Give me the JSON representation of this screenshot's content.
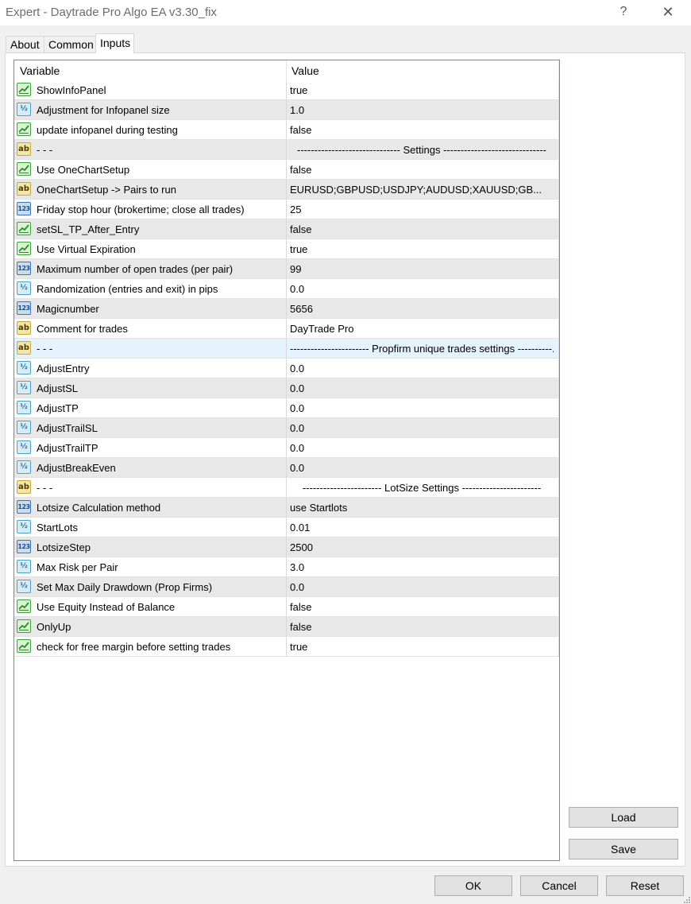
{
  "window": {
    "title": "Expert - Daytrade Pro Algo EA v3.30_fix",
    "help_label": "?",
    "close_label": "✕"
  },
  "tabs": [
    {
      "label": "About",
      "active": false
    },
    {
      "label": "Common",
      "active": false
    },
    {
      "label": "Inputs",
      "active": true
    }
  ],
  "grid": {
    "headers": {
      "variable": "Variable",
      "value": "Value"
    },
    "rows": [
      {
        "type": "bool",
        "icon": "bool-icon",
        "variable": "ShowInfoPanel",
        "value": "true"
      },
      {
        "type": "double",
        "icon": "double-icon",
        "variable": "Adjustment for Infopanel size",
        "value": "1.0"
      },
      {
        "type": "bool",
        "icon": "bool-icon",
        "variable": "update infopanel during testing",
        "value": "false"
      },
      {
        "type": "string",
        "icon": "string-icon",
        "variable": "- - -",
        "value": "------------------------------ Settings ------------------------------"
      },
      {
        "type": "bool",
        "icon": "bool-icon",
        "variable": "Use OneChartSetup",
        "value": "false"
      },
      {
        "type": "string",
        "icon": "string-icon",
        "variable": "OneChartSetup -> Pairs to run",
        "value": "EURUSD;GBPUSD;USDJPY;AUDUSD;XAUUSD;GB..."
      },
      {
        "type": "int",
        "icon": "int-icon",
        "variable": "Friday stop hour (brokertime; close all trades)",
        "value": "25"
      },
      {
        "type": "bool",
        "icon": "bool-icon",
        "variable": "setSL_TP_After_Entry",
        "value": "false"
      },
      {
        "type": "bool",
        "icon": "bool-icon",
        "variable": "Use Virtual Expiration",
        "value": "true"
      },
      {
        "type": "int",
        "icon": "int-icon",
        "variable": "Maximum number of open trades (per pair)",
        "value": "99"
      },
      {
        "type": "double",
        "icon": "double-icon",
        "variable": "Randomization (entries and exit) in pips",
        "value": "0.0"
      },
      {
        "type": "int",
        "icon": "int-icon",
        "variable": "Magicnumber",
        "value": "5656"
      },
      {
        "type": "string",
        "icon": "string-icon",
        "variable": "Comment for trades",
        "value": "DayTrade Pro"
      },
      {
        "type": "string",
        "icon": "string-icon",
        "variable": "- - -",
        "value": "----------------------- Propfirm unique trades settings ----------...",
        "selected": true
      },
      {
        "type": "double",
        "icon": "double-icon",
        "variable": "AdjustEntry",
        "value": "0.0"
      },
      {
        "type": "double",
        "icon": "double-icon",
        "variable": "AdjustSL",
        "value": "0.0"
      },
      {
        "type": "double",
        "icon": "double-icon",
        "variable": "AdjustTP",
        "value": "0.0"
      },
      {
        "type": "double",
        "icon": "double-icon",
        "variable": "AdjustTrailSL",
        "value": "0.0"
      },
      {
        "type": "double",
        "icon": "double-icon",
        "variable": "AdjustTrailTP",
        "value": "0.0"
      },
      {
        "type": "double",
        "icon": "double-icon",
        "variable": "AdjustBreakEven",
        "value": "0.0"
      },
      {
        "type": "string",
        "icon": "string-icon",
        "variable": "- - -",
        "value": "----------------------- LotSize Settings -----------------------"
      },
      {
        "type": "int",
        "icon": "int-icon",
        "variable": "Lotsize Calculation method",
        "value": "use Startlots"
      },
      {
        "type": "double",
        "icon": "double-icon",
        "variable": "StartLots",
        "value": "0.01"
      },
      {
        "type": "int",
        "icon": "int-icon",
        "variable": "LotsizeStep",
        "value": "2500"
      },
      {
        "type": "double",
        "icon": "double-icon",
        "variable": "Max Risk per Pair",
        "value": "3.0"
      },
      {
        "type": "double",
        "icon": "double-icon",
        "variable": "Set Max Daily Drawdown (Prop Firms)",
        "value": "0.0"
      },
      {
        "type": "bool",
        "icon": "bool-icon",
        "variable": "Use Equity Instead of Balance",
        "value": "false"
      },
      {
        "type": "bool",
        "icon": "bool-icon",
        "variable": "OnlyUp",
        "value": "false"
      },
      {
        "type": "bool",
        "icon": "bool-icon",
        "variable": "check for free margin before setting trades",
        "value": "true"
      }
    ]
  },
  "side_buttons": {
    "load": "Load",
    "save": "Save"
  },
  "footer_buttons": {
    "ok": "OK",
    "cancel": "Cancel",
    "reset": "Reset"
  },
  "icon_glyphs": {
    "string": "ab",
    "double": "½",
    "int": "123"
  }
}
